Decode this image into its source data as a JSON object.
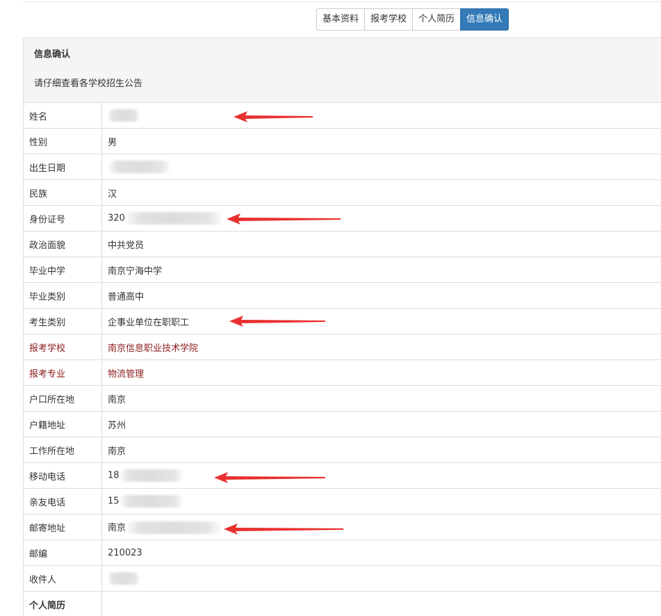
{
  "tabs": [
    {
      "label": "基本资料",
      "active": false
    },
    {
      "label": "报考学校",
      "active": false
    },
    {
      "label": "个人简历",
      "active": false
    },
    {
      "label": "信息确认",
      "active": true
    }
  ],
  "panel": {
    "title": "信息确认",
    "notice": "请仔细查看各学校招生公告"
  },
  "fields": [
    {
      "label": "姓名",
      "value": ""
    },
    {
      "label": "性别",
      "value": "男"
    },
    {
      "label": "出生日期",
      "value": ""
    },
    {
      "label": "民族",
      "value": "汉"
    },
    {
      "label": "身份证号",
      "value": "320"
    },
    {
      "label": "政治面貌",
      "value": "中共党员"
    },
    {
      "label": "毕业中学",
      "value": "南京宁海中学"
    },
    {
      "label": "毕业类别",
      "value": "普通高中"
    },
    {
      "label": "考生类别",
      "value": "企事业单位在职职工"
    },
    {
      "label": "报考学校",
      "value": "南京信息职业技术学院"
    },
    {
      "label": "报考专业",
      "value": "物流管理"
    },
    {
      "label": "户口所在地",
      "value": "南京"
    },
    {
      "label": "户籍地址",
      "value": "苏州"
    },
    {
      "label": "工作所在地",
      "value": "南京"
    },
    {
      "label": "移动电话",
      "value": "18"
    },
    {
      "label": "亲友电话",
      "value": "15"
    },
    {
      "label": "邮寄地址",
      "value": "南京"
    },
    {
      "label": "邮编",
      "value": "210023"
    },
    {
      "label": "收件人",
      "value": ""
    }
  ],
  "section": {
    "label": "个人简历"
  },
  "colors": {
    "accent": "#337ab7",
    "highlight_text": "#8b1a1a",
    "annotation_arrow": "#e8302f"
  }
}
